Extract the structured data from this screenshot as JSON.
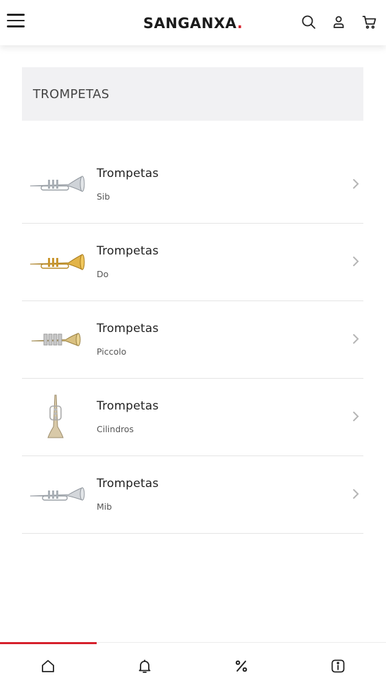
{
  "header": {
    "logo_text": "SANGANXA",
    "logo_dot": ".",
    "icons": [
      "menu-icon",
      "search-icon",
      "user-icon",
      "cart-icon"
    ]
  },
  "page": {
    "title": "TROMPETAS"
  },
  "categories": [
    {
      "name": "Trompetas",
      "subtitle": "Sib",
      "image": "silver-trumpet"
    },
    {
      "name": "Trompetas",
      "subtitle": "Do",
      "image": "gold-trumpet"
    },
    {
      "name": "Trompetas",
      "subtitle": "Piccolo",
      "image": "piccolo-trumpet"
    },
    {
      "name": "Trompetas",
      "subtitle": "Cilindros",
      "image": "rotary-trumpet"
    },
    {
      "name": "Trompetas",
      "subtitle": "Mib",
      "image": "silver-trumpet"
    }
  ],
  "bottom_nav": {
    "items": [
      "home-icon",
      "bell-icon",
      "percent-icon",
      "info-icon"
    ],
    "active_index": 0
  },
  "colors": {
    "accent": "#d6202b",
    "title_bg": "#f1f1f3",
    "divider": "#e4e4e4"
  }
}
